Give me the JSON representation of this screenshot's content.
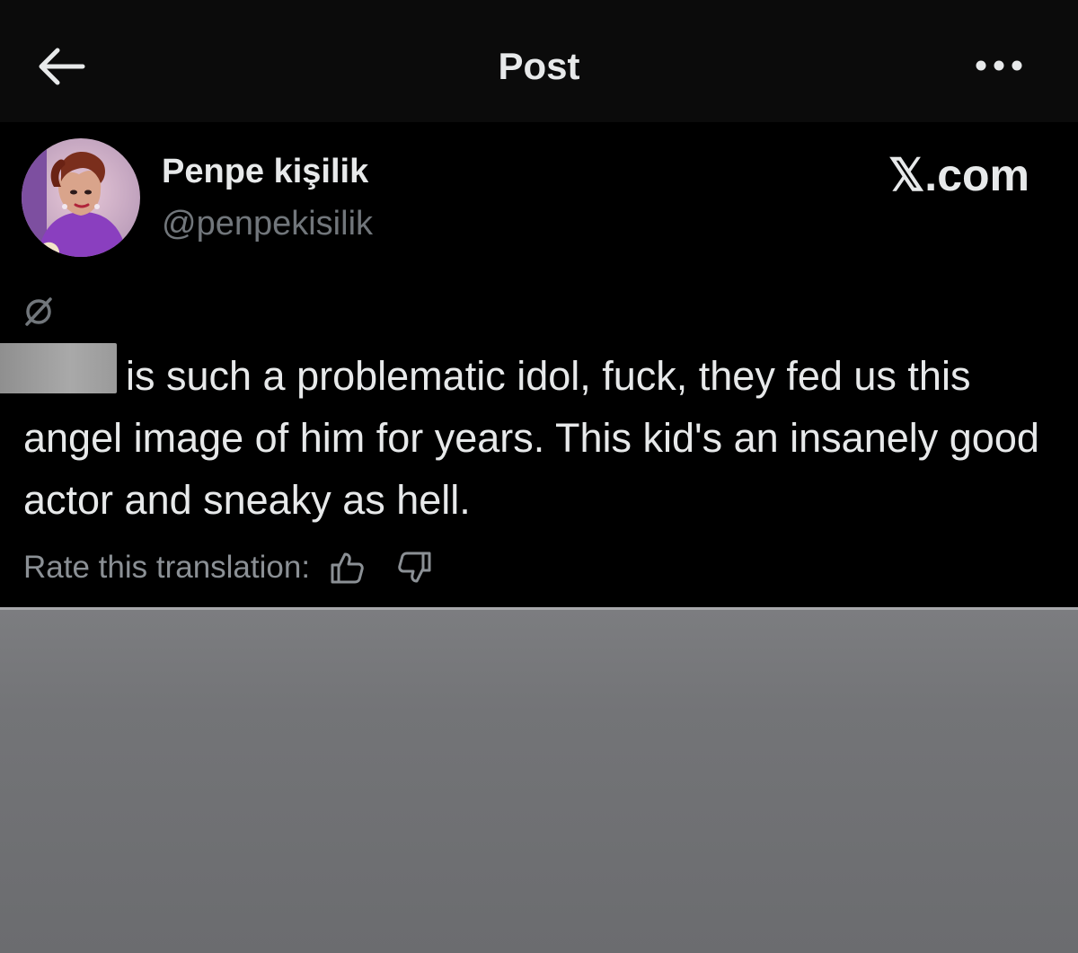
{
  "header": {
    "title": "Post",
    "back_icon": "arrow-left-icon",
    "more_icon": "more-horizontal-icon"
  },
  "post": {
    "author": {
      "display_name": "Penpe kişilik",
      "handle": "@penpekisilik",
      "avatar_icon": "avatar-photo"
    },
    "watermark": "𝕏.com",
    "translate_icon": "translate-icon",
    "text": "is such a problematic idol, fuck, they fed us this angel image of him for years. This kid's an insanely good actor and sneaky as hell.",
    "rate_translation": {
      "label": "Rate this translation:",
      "thumbs_up_icon": "thumbs-up-icon",
      "thumbs_down_icon": "thumbs-down-icon"
    }
  },
  "colors": {
    "background": "#000000",
    "header_background": "#0b0b0b",
    "text_primary": "#e7e9ea",
    "text_secondary": "#71767b",
    "redaction": "#9a9a9a",
    "paper": "#737477"
  }
}
